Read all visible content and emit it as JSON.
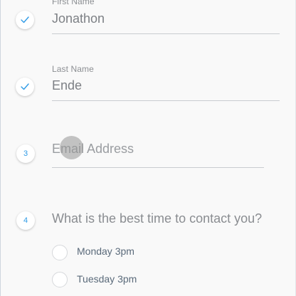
{
  "colors": {
    "accent": "#2f9be6",
    "background": "#f9f9f9",
    "text": "#7d8085"
  },
  "steps": [
    {
      "marker_icon": "checkmark-icon",
      "label": "First Name",
      "value": "Jonathon"
    },
    {
      "marker_icon": "checkmark-icon",
      "label": "Last Name",
      "value": "Ende"
    },
    {
      "marker_text": "3",
      "placeholder": "Email Address"
    },
    {
      "marker_text": "4",
      "question": "What is the best time to contact you?",
      "options": [
        {
          "label": "Monday 3pm",
          "selected": false
        },
        {
          "label": "Tuesday 3pm",
          "selected": false
        }
      ]
    }
  ]
}
